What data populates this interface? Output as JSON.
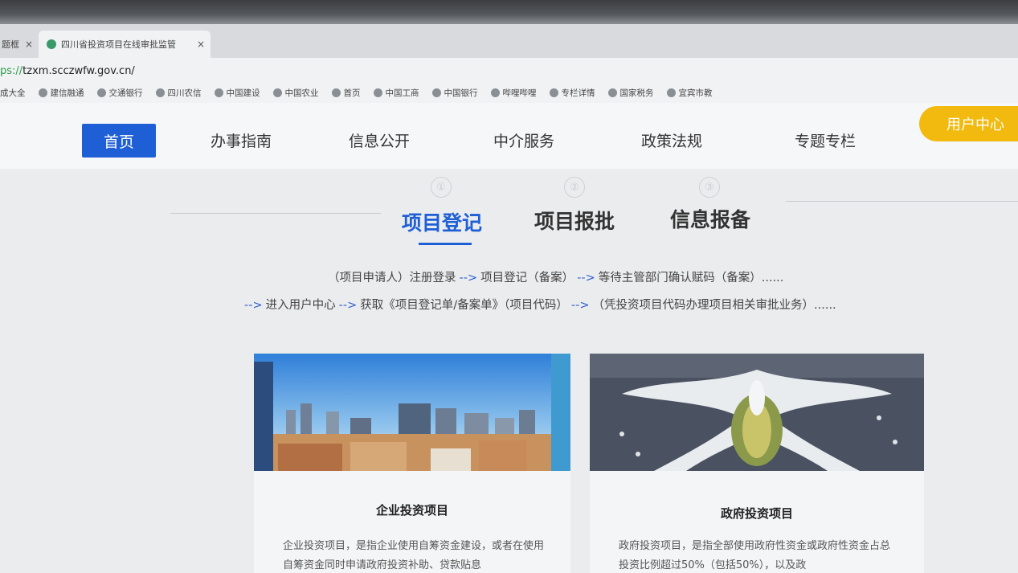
{
  "browser": {
    "prev_tab_label": "题框",
    "active_tab_title": "四川省投资项目在线审批监管",
    "close_glyph": "×",
    "new_tab_glyph": "+",
    "url_scheme": "ps://",
    "url_rest": "tzxm.scczwfw.gov.cn/",
    "bookmarks": [
      "成大全",
      "建信融通",
      "交通银行",
      "四川农信",
      "中国建设",
      "中国农业",
      "首页",
      "中国工商",
      "中国银行",
      "哔哩哔哩",
      "专栏详情",
      "国家税务",
      "宜宾市教"
    ]
  },
  "site_nav": {
    "items": [
      "首页",
      "办事指南",
      "信息公开",
      "中介服务",
      "政策法规",
      "专题专栏"
    ],
    "user_center": "用户中心"
  },
  "steps": {
    "circles": [
      "①",
      "②",
      "③"
    ],
    "tabs": [
      "项目登记",
      "项目报批",
      "信息报备"
    ]
  },
  "flow": {
    "line1": [
      "（项目申请人）注册登录",
      "项目登记（备案）",
      "等待主管部门确认赋码（备案）......"
    ],
    "line2": [
      "进入用户中心",
      "获取《项目登记单/备案单》（项目代码）",
      "（凭投资项目代码办理项目相关审批业务）......"
    ],
    "arrow": "-->"
  },
  "cards": [
    {
      "title": "企业投资项目",
      "desc": "企业投资项目，是指企业使用自筹资金建设，或者在使用自筹资金同时申请政府投资补助、贷款贴息"
    },
    {
      "title": "政府投资项目",
      "desc": "政府投资项目，是指全部使用政府性资金或政府性资金占总投资比例超过50%（包括50%），以及政"
    }
  ],
  "colors": {
    "primary": "#1e5fd6",
    "accent": "#f2b90f"
  }
}
